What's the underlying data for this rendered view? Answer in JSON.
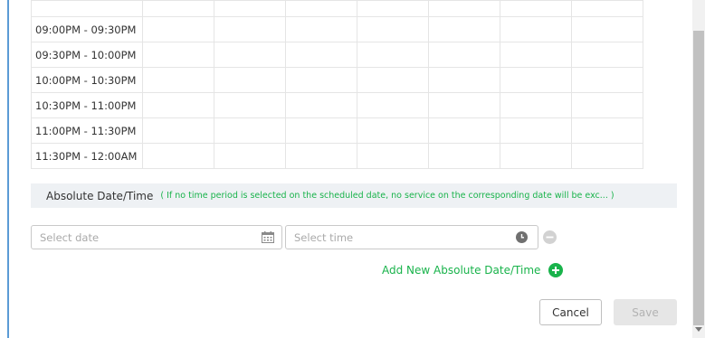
{
  "time_slots": [
    "09:00PM - 09:30PM",
    "09:30PM - 10:00PM",
    "10:00PM - 10:30PM",
    "10:30PM - 11:00PM",
    "11:00PM - 11:30PM",
    "11:30PM - 12:00AM"
  ],
  "absolute": {
    "title": "Absolute Date/Time",
    "hint": "( If no time period is selected on the scheduled date, no service on the corresponding date will be exc... )"
  },
  "date_input": {
    "placeholder": "Select date",
    "icon": "calendar-icon"
  },
  "time_input": {
    "placeholder": "Select time",
    "icon": "clock-icon"
  },
  "add_new": {
    "label": "Add New Absolute Date/Time",
    "icon": "plus-circle-icon"
  },
  "buttons": {
    "cancel": "Cancel",
    "save": "Save"
  },
  "colors": {
    "accent_green": "#19b34b",
    "frame_border": "#5b9bd5",
    "section_bg": "#eef1f4"
  }
}
